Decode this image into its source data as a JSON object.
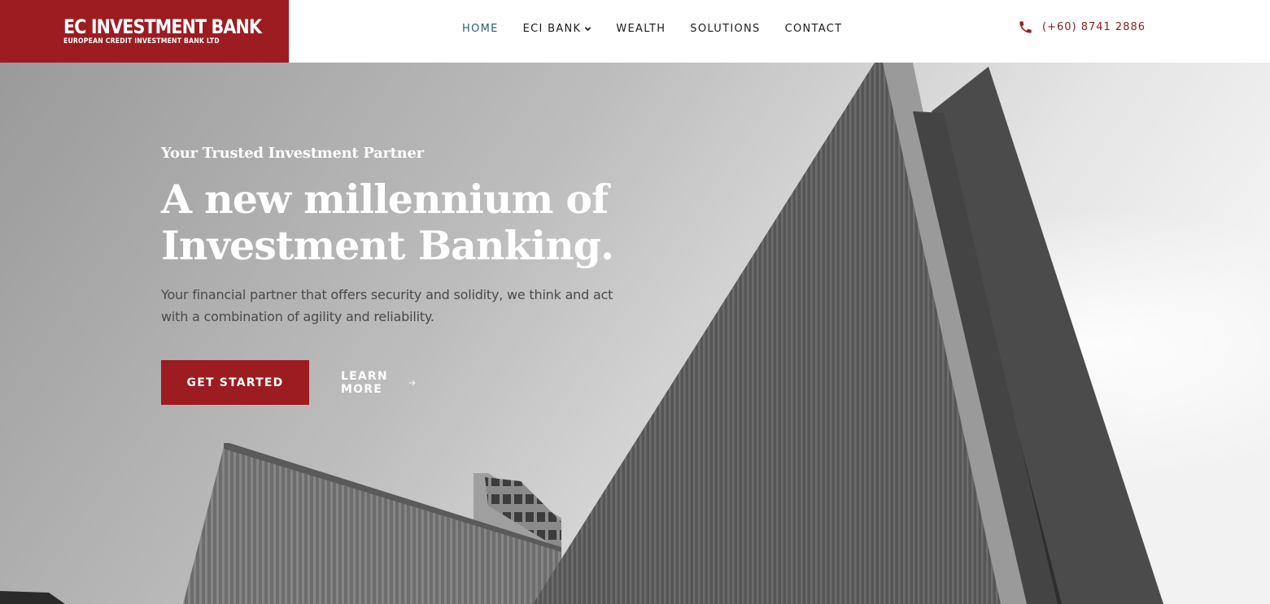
{
  "brand": {
    "name": "EC INVESTMENT BANK",
    "subtitle": "EUROPEAN CREDIT INVESTMENT BANK LTD",
    "color": "#9c1c21",
    "logo_icon": "interlocked-circle-logo-icon"
  },
  "nav": {
    "items": [
      {
        "label": "HOME",
        "active": true
      },
      {
        "label": "ECI BANK",
        "has_dropdown": true
      },
      {
        "label": "WEALTH"
      },
      {
        "label": "SOLUTIONS"
      },
      {
        "label": "CONTACT"
      }
    ],
    "active_color": "#2b5e70"
  },
  "phone": {
    "icon": "phone-icon",
    "number": "(+60) 8741 2886"
  },
  "hero": {
    "tagline": "Your Trusted Investment Partner",
    "headline_line1": "A new millennium of",
    "headline_line2": "Investment Banking.",
    "description": "Your financial partner that offers security and solidity, we think and act with a combination of agility and reliability.",
    "primary_button": "GET STARTED",
    "secondary_link": "LEARN MORE",
    "secondary_icon": "arrow-right-icon",
    "background": "grayscale-skyscraper-photo"
  }
}
